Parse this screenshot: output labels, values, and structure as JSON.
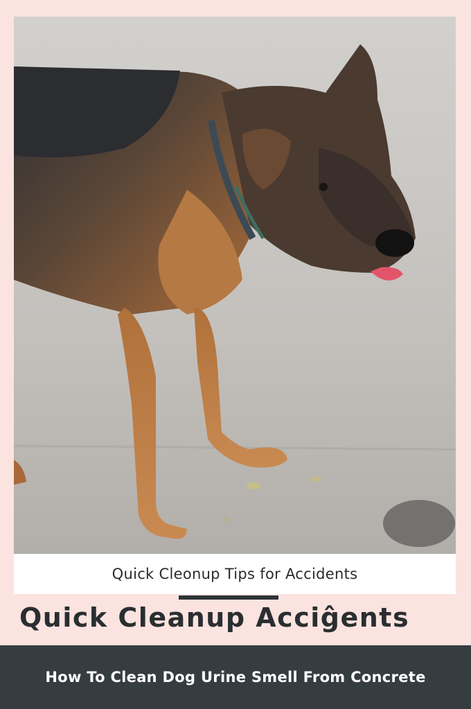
{
  "photo": {
    "subject": "dog-standing-on-concrete"
  },
  "caption": {
    "text": "Quick Cleonup Tips for Accidents"
  },
  "headline": {
    "text": "Quick Cleanup Acciĝents"
  },
  "footer": {
    "text": "How To Clean Dog Urine Smell From Concrete"
  },
  "colors": {
    "background": "#fbe3df",
    "footer_bg": "#363d40",
    "headline": "#2a2e31",
    "caption_bg": "#ffffff"
  }
}
